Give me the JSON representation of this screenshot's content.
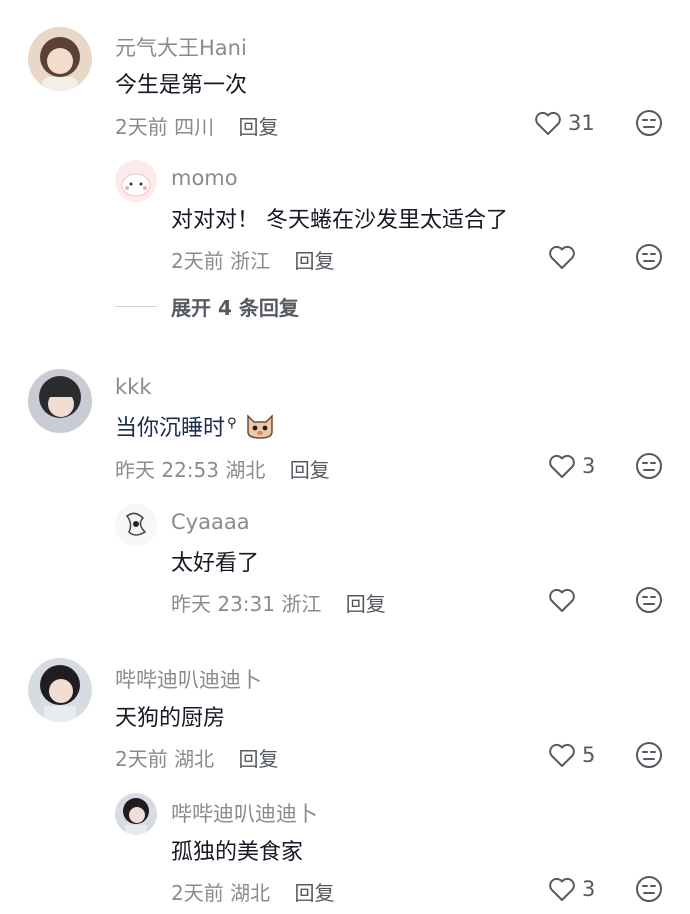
{
  "comments": [
    {
      "user": "元气大王Hani",
      "text": "今生是第一次",
      "date": "2天前",
      "location": "四川",
      "reply_label": "回复",
      "likes": "31",
      "replies": [
        {
          "user": "momo",
          "text": "对对对！ 冬天蜷在沙发里太适合了",
          "date": "2天前",
          "location": "浙江",
          "reply_label": "回复",
          "likes": ""
        }
      ],
      "expand_label": "展开 4 条回复"
    },
    {
      "user": "kkk",
      "text": "当你沉睡时",
      "date": "昨天 22:53",
      "location": "湖北",
      "reply_label": "回复",
      "likes": "3",
      "emoji": "cat-emoji",
      "replies": [
        {
          "user": "Cyaaaa",
          "text": "太好看了",
          "date": "昨天 23:31",
          "location": "浙江",
          "reply_label": "回复",
          "likes": ""
        }
      ]
    },
    {
      "user": "哔哔迪叭迪迪卜",
      "text": "天狗的厨房",
      "date": "2天前",
      "location": "湖北",
      "reply_label": "回复",
      "likes": "5",
      "replies": [
        {
          "user": "哔哔迪叭迪迪卜",
          "text": "孤独的美食家",
          "date": "2天前",
          "location": "湖北",
          "reply_label": "回复",
          "likes": "3"
        }
      ]
    }
  ],
  "icons": {
    "like": "heart-outline-icon",
    "dislike": "unhappy-face-icon",
    "search_hint": "search-icon"
  },
  "colors": {
    "primary_text": "#161823",
    "secondary_text": "#8a8b91",
    "icon": "#555a61"
  }
}
